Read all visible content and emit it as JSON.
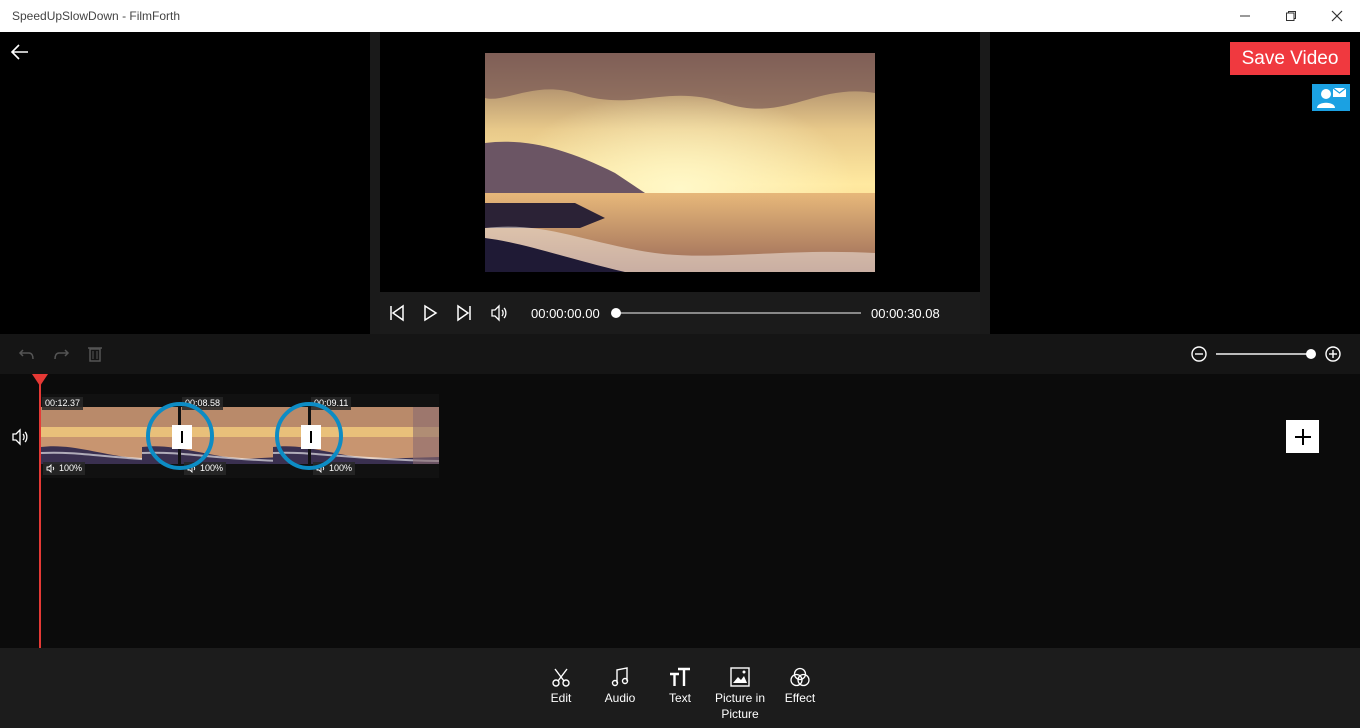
{
  "window": {
    "title": "SpeedUpSlowDown - FilmForth",
    "min_icon": "minimize-icon",
    "max_icon": "maximize-icon",
    "close_icon": "close-icon"
  },
  "header": {
    "back_icon": "arrow-left-icon",
    "save_label": "Save Video",
    "contact_icon": "contact-mail-icon"
  },
  "player": {
    "current_time": "00:00:00.00",
    "total_time": "00:00:30.08",
    "progress_fraction": 0.0,
    "icons": [
      "skip-previous-icon",
      "play-icon",
      "skip-next-icon",
      "volume-icon"
    ]
  },
  "toolbar": {
    "icons": [
      "undo-icon",
      "redo-icon",
      "delete-icon",
      "zoom-out-icon",
      "zoom-in-icon"
    ],
    "zoom_fraction": 1.0
  },
  "timeline": {
    "clips": [
      {
        "duration": "00:12.37",
        "volume": "100%"
      },
      {
        "duration": "00:08.58",
        "volume": "100%"
      },
      {
        "duration": "00:09.11",
        "volume": "100%"
      }
    ]
  },
  "bottom": {
    "items": [
      {
        "label": "Edit",
        "icon": "scissors-icon"
      },
      {
        "label": "Audio",
        "icon": "music-note-icon"
      },
      {
        "label": "Text",
        "icon": "text-icon"
      },
      {
        "label": "Picture in Picture",
        "icon": "picture-icon"
      },
      {
        "label": "Effect",
        "icon": "effect-icon"
      }
    ]
  },
  "colors": {
    "accent_red": "#f0393f",
    "accent_blue": "#1ba1e2",
    "transition_ring": "#0d8cc4",
    "playhead": "#e53935"
  }
}
